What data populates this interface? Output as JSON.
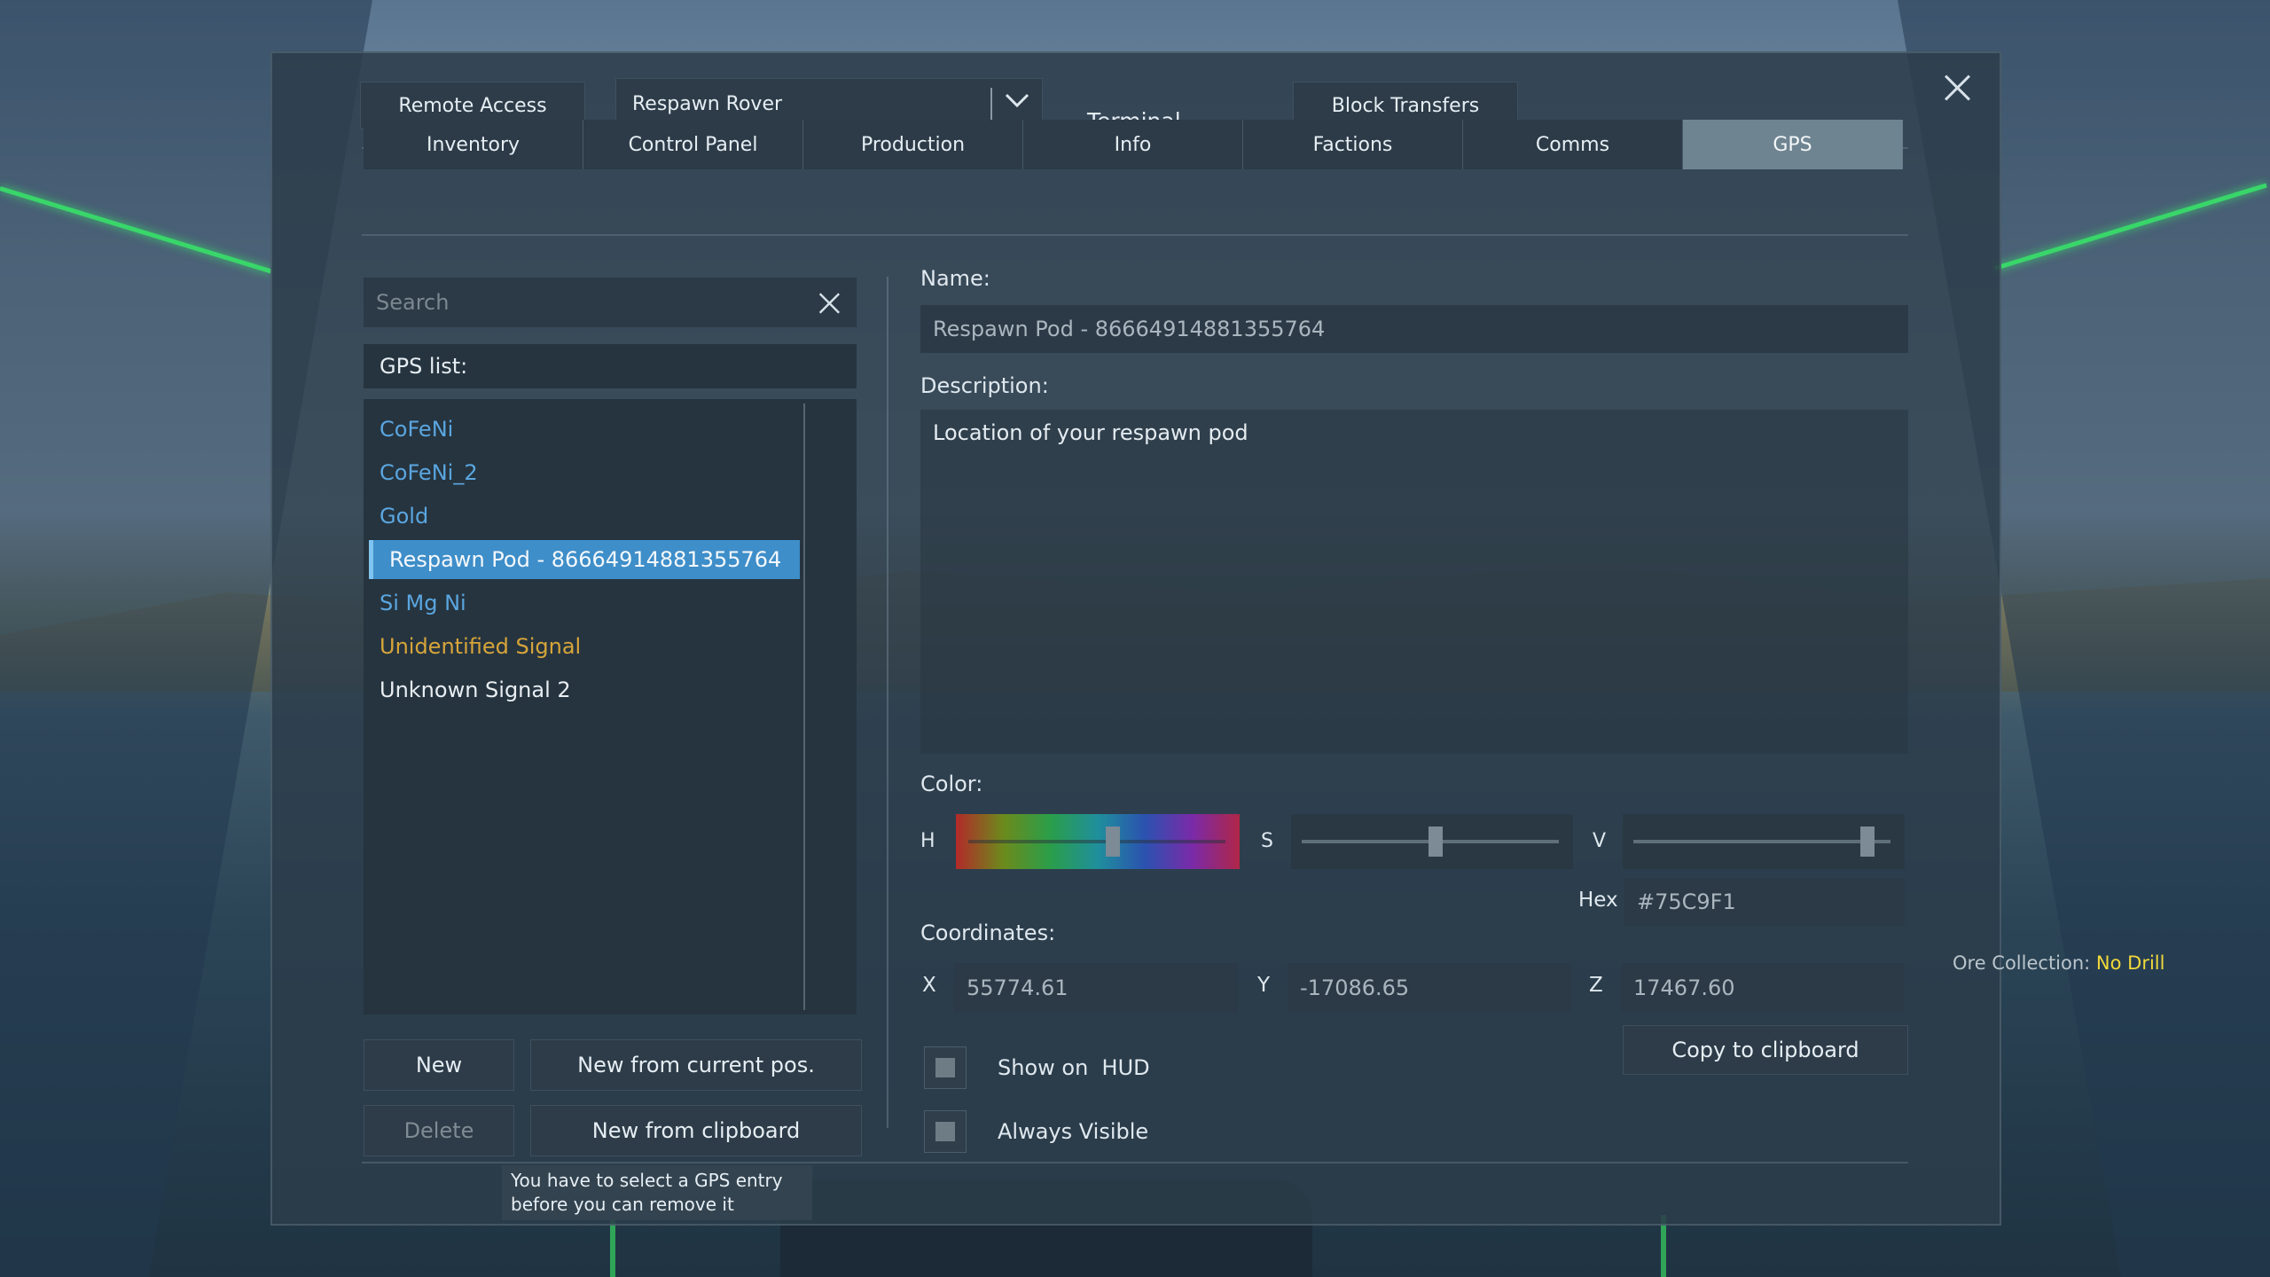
{
  "header": {
    "remote_access": "Remote Access",
    "grid_select": "Respawn Rover",
    "title": "Terminal",
    "block_transfers": "Block Transfers"
  },
  "tabs": [
    {
      "label": "Inventory"
    },
    {
      "label": "Control Panel"
    },
    {
      "label": "Production"
    },
    {
      "label": "Info"
    },
    {
      "label": "Factions"
    },
    {
      "label": "Comms"
    },
    {
      "label": "GPS",
      "active": true
    }
  ],
  "left": {
    "search_placeholder": "Search",
    "list_header": "GPS list:",
    "items": [
      {
        "label": "CoFeNi",
        "color": "#5aa6e0"
      },
      {
        "label": "CoFeNi_2",
        "color": "#5aa6e0"
      },
      {
        "label": "Gold",
        "color": "#5aa6e0"
      },
      {
        "label": "Respawn Pod - 86664914881355764",
        "selected": true
      },
      {
        "label": "Si Mg Ni",
        "color": "#5aa6e0"
      },
      {
        "label": "Unidentified Signal",
        "color": "#d7a53a"
      },
      {
        "label": "Unknown Signal 2",
        "color": "#e8eef2"
      }
    ],
    "btn_new": "New",
    "btn_new_current": "New from current pos.",
    "btn_delete": "Delete",
    "btn_new_clipboard": "New from clipboard",
    "tooltip_line1": "You have to select a GPS entry",
    "tooltip_line2": "before you can remove it"
  },
  "right": {
    "name_label": "Name:",
    "name_value": "Respawn Pod - 86664914881355764",
    "desc_label": "Description:",
    "desc_value": "Location of your respawn pod",
    "color_label": "Color:",
    "h_label": "H",
    "s_label": "S",
    "v_label": "V",
    "hex_label": "Hex",
    "hex_value": "#75C9F1",
    "coords_label": "Coordinates:",
    "x_label": "X",
    "x_value": "55774.61",
    "y_label": "Y",
    "y_value": "-17086.65",
    "z_label": "Z",
    "z_value": "17467.60",
    "show_hud": "Show on  HUD",
    "always_visible": "Always Visible",
    "copy_clipboard": "Copy to clipboard",
    "hue_level": 0.57,
    "sat_level": 0.52,
    "val_level": 0.91
  },
  "hud": {
    "ore_label": "Ore Collection: ",
    "ore_value": "No Drill"
  }
}
